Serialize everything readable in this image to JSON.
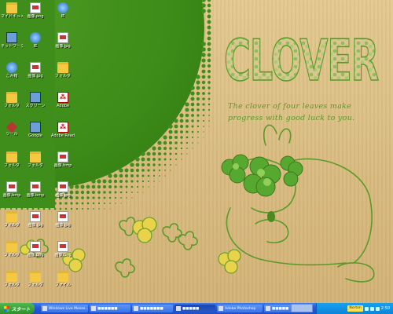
{
  "wallpaper": {
    "title": "CLOVER",
    "tagline": "The clover of four leaves make progress with good luck to you.",
    "colors": {
      "green": "#3f8d1a",
      "paper": "#dcc08a",
      "text_green": "#5a9a2a"
    }
  },
  "desktop_icons": [
    {
      "name": "icon-1",
      "label": "マイドキュメント",
      "kind": "folder"
    },
    {
      "name": "icon-2",
      "label": "ネットワーク",
      "kind": "pc"
    },
    {
      "name": "icon-3",
      "label": "ごみ箱",
      "kind": "globe"
    },
    {
      "name": "icon-4",
      "label": "フォルダ",
      "kind": "folder"
    },
    {
      "name": "icon-5",
      "label": "ツール",
      "kind": "tool"
    },
    {
      "name": "icon-6",
      "label": "フォルダ",
      "kind": "folder"
    },
    {
      "name": "icon-7",
      "label": "画像.bmp",
      "kind": "doc"
    },
    {
      "name": "icon-8",
      "label": "フォルダ",
      "kind": "folder"
    },
    {
      "name": "icon-9",
      "label": "フォルダ",
      "kind": "folder"
    },
    {
      "name": "icon-10",
      "label": "フォルダ",
      "kind": "folder"
    },
    {
      "name": "icon-11",
      "label": "画像.png",
      "kind": "doc"
    },
    {
      "name": "icon-12",
      "label": "IE",
      "kind": "globe"
    },
    {
      "name": "icon-13",
      "label": "画像.jpg",
      "kind": "doc"
    },
    {
      "name": "icon-14",
      "label": "スクリーン",
      "kind": "pc"
    },
    {
      "name": "icon-15",
      "label": "Google",
      "kind": "pc"
    },
    {
      "name": "icon-16",
      "label": "フォルダ",
      "kind": "folder"
    },
    {
      "name": "icon-17",
      "label": "画像.bmp",
      "kind": "doc"
    },
    {
      "name": "icon-18",
      "label": "画像.jpg",
      "kind": "doc"
    },
    {
      "name": "icon-19",
      "label": "画像.png",
      "kind": "doc"
    },
    {
      "name": "icon-20",
      "label": "フォルダ",
      "kind": "folder"
    },
    {
      "name": "icon-21",
      "label": "IE",
      "kind": "globe"
    },
    {
      "name": "icon-22",
      "label": "画像.jpg",
      "kind": "doc"
    },
    {
      "name": "icon-23",
      "label": "フォルダ",
      "kind": "folder"
    },
    {
      "name": "icon-24",
      "label": "Adobe",
      "kind": "pdf"
    },
    {
      "name": "icon-25",
      "label": "Adobe Reader",
      "kind": "pdf"
    },
    {
      "name": "icon-26",
      "label": "画像.bmp",
      "kind": "doc"
    },
    {
      "name": "icon-27",
      "label": "画像.jpg",
      "kind": "doc"
    },
    {
      "name": "icon-28",
      "label": "画像.jpg",
      "kind": "doc"
    },
    {
      "name": "icon-29",
      "label": "画像.png",
      "kind": "doc"
    },
    {
      "name": "icon-30",
      "label": "ファイル",
      "kind": "folder"
    }
  ],
  "taskbar": {
    "start_label": "スタート",
    "tasks": [
      {
        "label": "Windows Live Messe...",
        "active": false
      },
      {
        "label": "■■■■■■",
        "active": false
      },
      {
        "label": "■■■■■■■",
        "active": false
      },
      {
        "label": "■■■■■",
        "active": true
      },
      {
        "label": "Adobe Photoshop",
        "active": false
      },
      {
        "label": "■■■■■",
        "active": false
      }
    ],
    "norton": "Norton",
    "clock": "2:50"
  }
}
